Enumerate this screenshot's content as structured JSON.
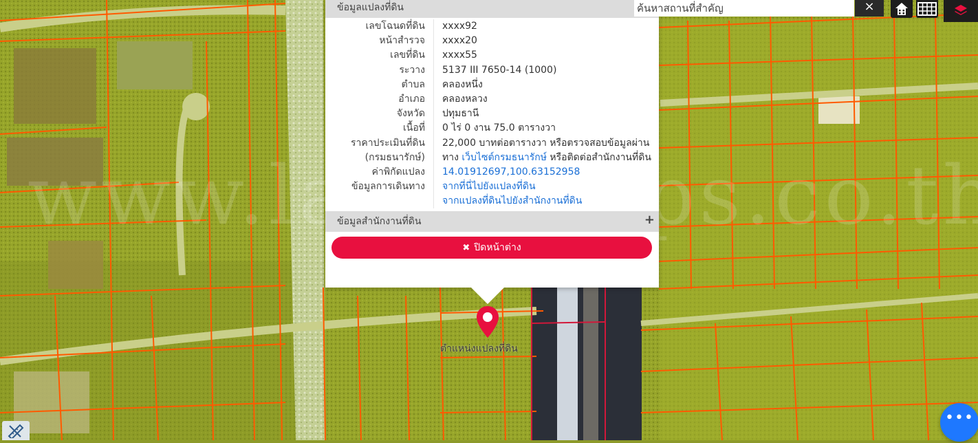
{
  "popup": {
    "header": "ข้อมูลแปลงที่ดิน",
    "rows": [
      {
        "label": "เลขโฉนดที่ดิน",
        "value": "xxxx92"
      },
      {
        "label": "หน้าสำรวจ",
        "value": "xxxx20"
      },
      {
        "label": "เลขที่ดิน",
        "value": "xxxx55"
      },
      {
        "label": "ระวาง",
        "value": "5137 III 7650-14 (1000)"
      },
      {
        "label": "ตำบล",
        "value": "คลองหนึ่ง"
      },
      {
        "label": "อำเภอ",
        "value": "คลองหลวง"
      },
      {
        "label": "จังหวัด",
        "value": "ปทุมธานี"
      },
      {
        "label": "เนื้อที่",
        "value": "0 ไร่ 0 งาน 75.0 ตารางวา"
      }
    ],
    "price": {
      "label_line1": "ราคาประเมินที่ดิน",
      "label_line2": "(กรมธนารักษ์)",
      "value_line1": "22,000 บาทต่อตารางวา หรือตรวจสอบข้อมูลผ่าน",
      "value_line2_prefix": "ทาง ",
      "value_line2_link": "เว็บไซต์กรมธนารักษ์",
      "value_line2_suffix": " หรือติดต่อสำนักงานที่ดิน"
    },
    "coords": {
      "label": "ค่าพิกัดแปลง",
      "value": "14.01912697,100.63152958"
    },
    "directions": {
      "label": "ข้อมูลการเดินทาง",
      "link1": "จากที่นี่ไปยังแปลงที่ดิน",
      "link2": "จากแปลงที่ดินไปยังสำนักงานที่ดิน"
    },
    "office_section": "ข้อมูลสำนักงานที่ดิน",
    "expand_symbol": "+",
    "close_icon_glyph": "✖",
    "close_label": "ปิดหน้าต่าง"
  },
  "search": {
    "placeholder": "ค้นหาสถานที่สำคัญ",
    "clear_glyph": "×"
  },
  "marker_label": "ตำแหน่งแปลงที่ดิน",
  "watermark": "www.landsmaps.co.th",
  "fab_glyph": "•••",
  "colors": {
    "parcel_line": "#ff5a00",
    "popup_close": "#e8103f",
    "marker": "#e8103f",
    "fab": "#1e78ff",
    "link": "#1a6fd6"
  }
}
